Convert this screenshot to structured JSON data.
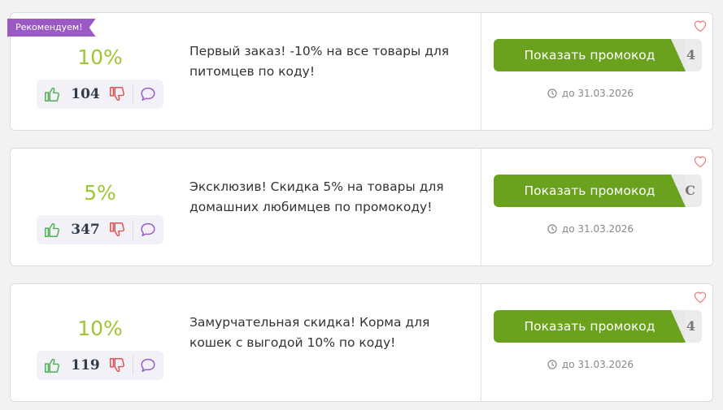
{
  "recommended_label": "Рекомендуем!",
  "button_label": "Показать промокод",
  "colors": {
    "discount": "#9ec532",
    "button": "#6aa11d",
    "ribbon": "#9b59c6"
  },
  "offers": [
    {
      "discount": "10%",
      "votes": "104",
      "description": "Первый заказ! -10% на все товары для питомцев по коду!",
      "code_peek": "4",
      "expiry": "до 31.03.2026"
    },
    {
      "discount": "5%",
      "votes": "347",
      "description": "Эксклюзив! Скидка 5% на товары для домашних любимцев по промокоду!",
      "code_peek": "C",
      "expiry": "до 31.03.2026"
    },
    {
      "discount": "10%",
      "votes": "119",
      "description": "Замурчательная скидка! Корма для кошек с выгодой 10% по коду!",
      "code_peek": "4",
      "expiry": "до 31.03.2026"
    }
  ]
}
